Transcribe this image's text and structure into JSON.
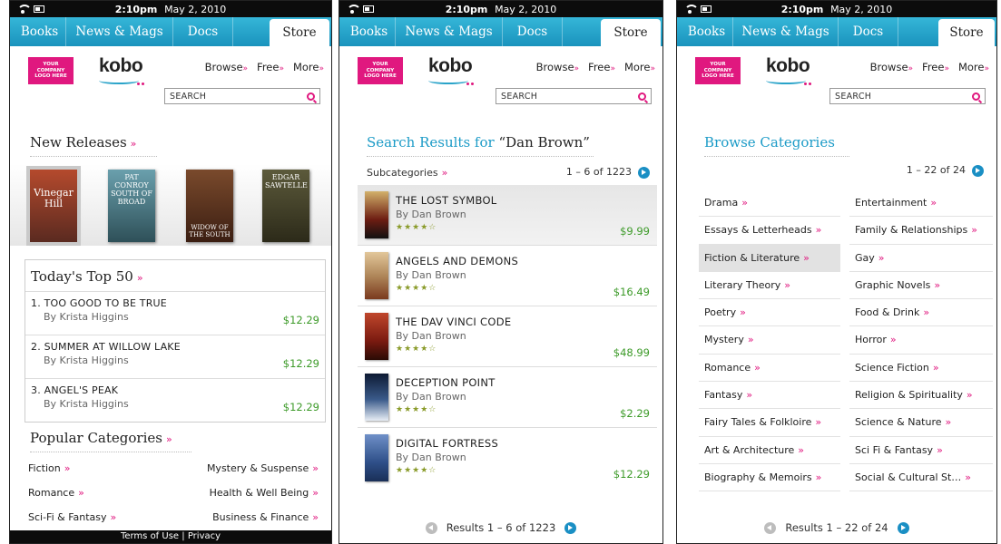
{
  "status": {
    "time": "2:10pm",
    "date": "May 2, 2010"
  },
  "tabs": [
    "Books",
    "News & Mags",
    "Docs",
    "Store"
  ],
  "header": {
    "company_logo": "YOUR COMPANY LOGO HERE",
    "brand": "kobo",
    "nav": [
      "Browse",
      "Free",
      "More"
    ],
    "search_placeholder": "SEARCH"
  },
  "colors": {
    "tabbar": "#1a93bd",
    "accent_pink": "#e0187f",
    "price_green": "#3c9a28",
    "pager_blue": "#1a8fc4"
  },
  "screen1": {
    "new_releases_title": "New Releases",
    "covers": [
      {
        "title": "Vinegar Hill",
        "color": "#7b3b2e"
      },
      {
        "title": "PAT CONROY SOUTH OF BROAD",
        "color": "#3a6c76"
      },
      {
        "title": "WIDOW OF THE SOUTH",
        "color": "#4b2a1c"
      },
      {
        "title": "EDGAR SAWTELLE",
        "color": "#3b3a26"
      }
    ],
    "top50_title": "Today's Top 50",
    "top50": [
      {
        "title": "1. TOO GOOD TO BE TRUE",
        "author": "By Krista Higgins",
        "price": "$12.29"
      },
      {
        "title": "2. SUMMER AT WILLOW LAKE",
        "author": "By Krista Higgins",
        "price": "$12.29"
      },
      {
        "title": "3. ANGEL'S PEAK",
        "author": "By Krista Higgins",
        "price": "$12.29"
      }
    ],
    "popular_title": "Popular Categories",
    "popular": [
      [
        "Fiction",
        "Mystery & Suspense"
      ],
      [
        "Romance",
        "Health & Well Being"
      ],
      [
        "Sci-Fi & Fantasy",
        "Business & Finance"
      ]
    ],
    "footer": {
      "terms": "Terms of Use",
      "sep": "|",
      "privacy": "Privacy"
    }
  },
  "screen2": {
    "title_prefix": "Search Results for ",
    "query": "“Dan Brown”",
    "subcategories": "Subcategories",
    "count": "1 – 6 of 1223",
    "results": [
      {
        "title": "THE LOST SYMBOL",
        "author": "By Dan Brown",
        "stars": "★★★★☆",
        "price": "$9.99",
        "color": "#6d1d12"
      },
      {
        "title": "ANGELS AND DEMONS",
        "author": "By Dan Brown",
        "stars": "★★★★☆",
        "price": "$16.49",
        "color": "#b0875a"
      },
      {
        "title": "THE DAV VINCI CODE",
        "author": "By Dan Brown",
        "stars": "★★★★☆",
        "price": "$48.99",
        "color": "#7a1a10"
      },
      {
        "title": "DECEPTION POINT",
        "author": "By Dan Brown",
        "stars": "★★★★☆",
        "price": "$2.29",
        "color": "#1b2742"
      },
      {
        "title": "DIGITAL FORTRESS",
        "author": "By Dan Brown",
        "stars": "★★★★☆",
        "price": "$12.29",
        "color": "#2e4f88"
      }
    ],
    "pager": "Results 1 – 6 of 1223"
  },
  "screen3": {
    "title": "Browse Categories",
    "count": "1 – 22 of 24",
    "left": [
      "Drama",
      "Essays & Letterheads",
      "Fiction & Literature",
      "Literary Theory",
      "Poetry",
      "Mystery",
      "Romance",
      "Fantasy",
      "Fairy Tales & Folkloire",
      "Art & Architecture",
      "Biography & Memoirs"
    ],
    "right": [
      "Entertainment",
      "Family & Relationships",
      "Gay",
      "Graphic Novels",
      "Food & Drink",
      "Horror",
      "Science Fiction",
      "Religion & Spirituality",
      "Science & Nature",
      "Sci Fi & Fantasy",
      "Social & Cultural St…"
    ],
    "pager": "Results 1 – 22 of 24"
  }
}
